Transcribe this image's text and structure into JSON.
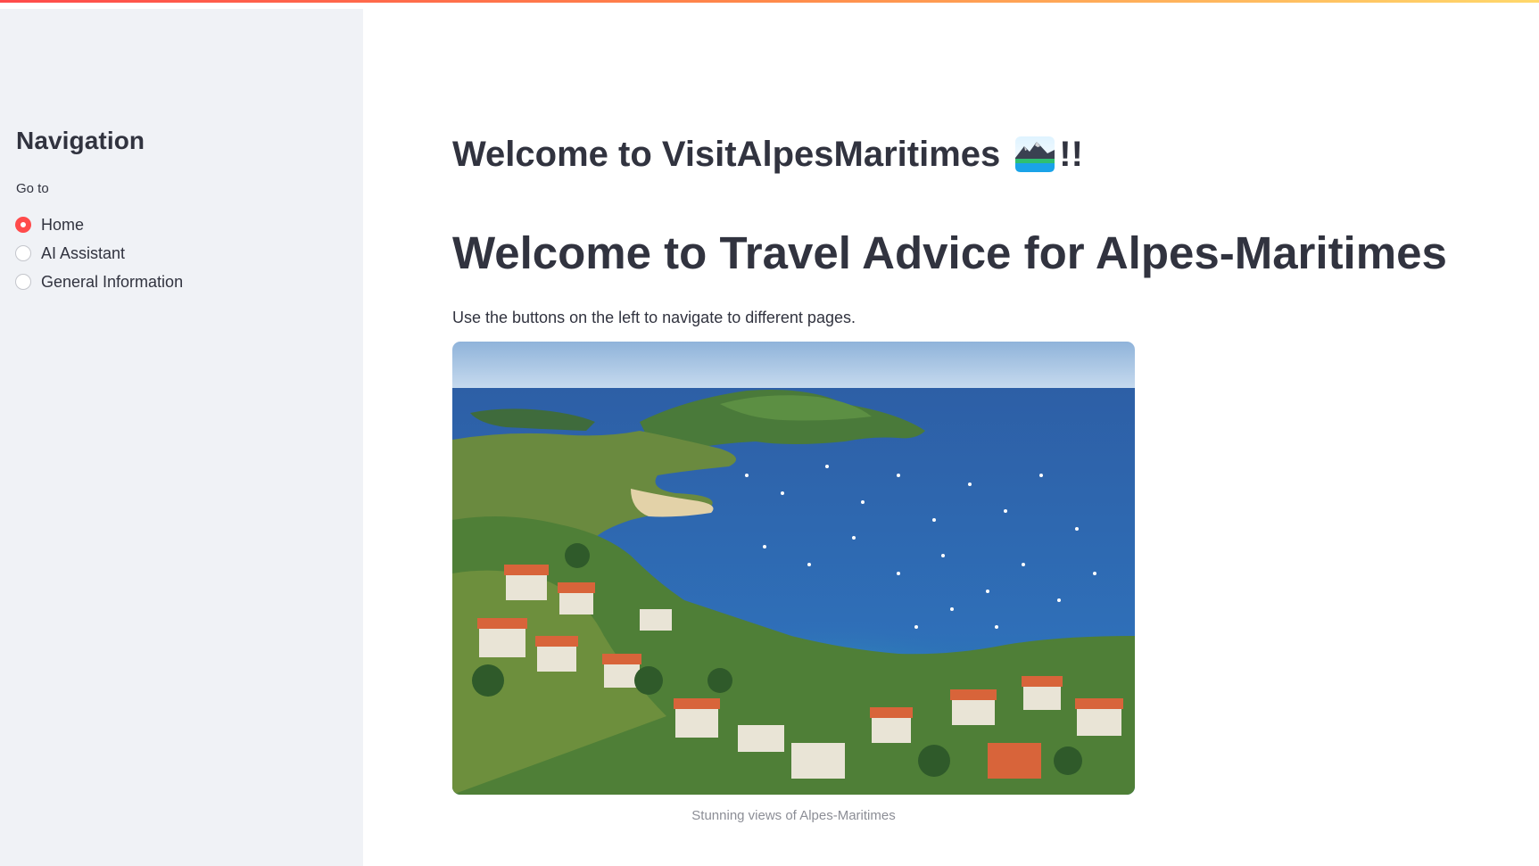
{
  "sidebar": {
    "title": "Navigation",
    "radio_label": "Go to",
    "options": [
      "Home",
      "AI Assistant",
      "General Information"
    ],
    "selected": "Home"
  },
  "main": {
    "title": "Welcome to VisitAlpesMaritimes",
    "title_icon": "mountain-lake-emoji-icon",
    "title_suffix": "!!",
    "heading": "Welcome to Travel Advice for Alpes-Maritimes",
    "intro": "Use the buttons on the left to navigate to different pages.",
    "image_caption": "Stunning views of Alpes-Maritimes"
  },
  "colors": {
    "accent": "#ff4b4b",
    "sidebar_bg": "#f0f2f6",
    "text": "#31333f",
    "caption": "#8c8e96"
  }
}
